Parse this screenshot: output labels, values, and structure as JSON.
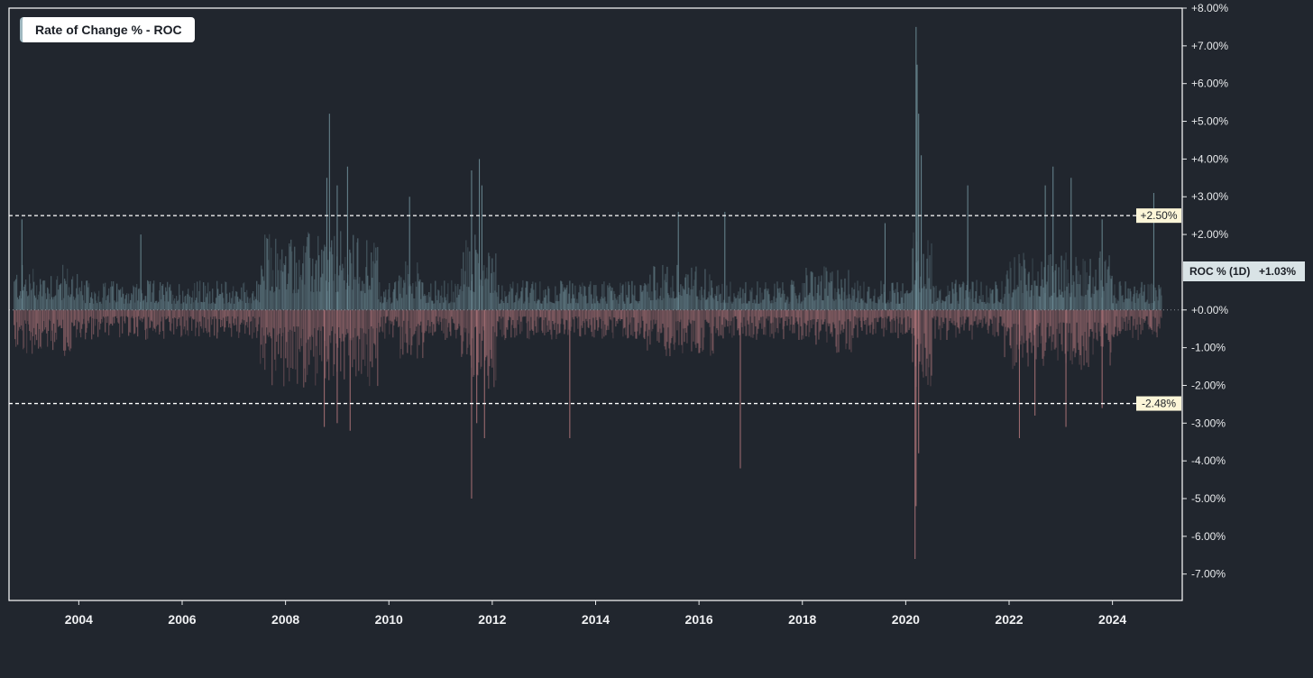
{
  "legend": {
    "title": "Rate of Change % - ROC"
  },
  "colors": {
    "background": "#21262e",
    "frame": "#ffffff",
    "positive": "#6f8f99",
    "negative": "#b0757a",
    "ref_line": "#ffffff",
    "ref_label_bg": "#fdf6d8",
    "roc_label_bg": "#d9e3e6"
  },
  "chart_data": {
    "type": "bar",
    "title": "Rate of Change % - ROC",
    "xlabel": "",
    "ylabel": "",
    "x_range": [
      2002.65,
      2025.35
    ],
    "ylim": [
      -7.7,
      8.0
    ],
    "x_ticks": [
      "2004",
      "2006",
      "2008",
      "2010",
      "2012",
      "2014",
      "2016",
      "2018",
      "2020",
      "2022",
      "2024"
    ],
    "y_ticks": [
      {
        "v": 8,
        "label": "+8.00%"
      },
      {
        "v": 7,
        "label": "+7.00%"
      },
      {
        "v": 6,
        "label": "+6.00%"
      },
      {
        "v": 5,
        "label": "+5.00%"
      },
      {
        "v": 4,
        "label": "+4.00%"
      },
      {
        "v": 3,
        "label": "+3.00%"
      },
      {
        "v": 2,
        "label": "+2.00%"
      },
      {
        "v": 0,
        "label": "+0.00%"
      },
      {
        "v": -1,
        "label": "-1.00%"
      },
      {
        "v": -2,
        "label": "-2.00%"
      },
      {
        "v": -3,
        "label": "-3.00%"
      },
      {
        "v": -4,
        "label": "-4.00%"
      },
      {
        "v": -5,
        "label": "-5.00%"
      },
      {
        "v": -6,
        "label": "-6.00%"
      },
      {
        "v": -7,
        "label": "-7.00%"
      }
    ],
    "reference_lines": [
      {
        "value": 2.5,
        "label": "+2.50%"
      },
      {
        "value": -2.48,
        "label": "-2.48%"
      }
    ],
    "current": {
      "label": "ROC % (1D)",
      "value_text": "+1.03%",
      "value": 1.03
    },
    "grid": false,
    "series": [
      {
        "type": "daily_bars",
        "x_start": 2002.75,
        "x_end": 2024.95,
        "spikes_up": [
          [
            2002.9,
            2.4
          ],
          [
            2005.2,
            2.0
          ],
          [
            2008.8,
            3.5
          ],
          [
            2008.85,
            5.2
          ],
          [
            2009.0,
            3.3
          ],
          [
            2009.2,
            3.8
          ],
          [
            2010.4,
            3.0
          ],
          [
            2011.6,
            3.7
          ],
          [
            2011.75,
            4.0
          ],
          [
            2011.8,
            3.3
          ],
          [
            2015.6,
            2.6
          ],
          [
            2016.5,
            2.6
          ],
          [
            2019.6,
            2.3
          ],
          [
            2020.2,
            7.5
          ],
          [
            2020.22,
            6.5
          ],
          [
            2020.25,
            5.2
          ],
          [
            2020.3,
            4.1
          ],
          [
            2021.2,
            3.3
          ],
          [
            2022.7,
            3.3
          ],
          [
            2022.85,
            3.8
          ],
          [
            2023.2,
            3.5
          ],
          [
            2023.8,
            2.4
          ],
          [
            2024.8,
            3.1
          ]
        ],
        "spikes_down": [
          [
            2008.75,
            -3.1
          ],
          [
            2009.0,
            -3.0
          ],
          [
            2009.25,
            -3.2
          ],
          [
            2011.6,
            -5.0
          ],
          [
            2011.7,
            -3.0
          ],
          [
            2011.85,
            -3.4
          ],
          [
            2013.5,
            -3.4
          ],
          [
            2016.8,
            -4.2
          ],
          [
            2020.18,
            -6.6
          ],
          [
            2020.2,
            -5.2
          ],
          [
            2020.25,
            -3.8
          ],
          [
            2022.2,
            -3.4
          ],
          [
            2022.5,
            -2.8
          ],
          [
            2023.1,
            -3.1
          ],
          [
            2023.8,
            -2.6
          ]
        ]
      }
    ]
  }
}
